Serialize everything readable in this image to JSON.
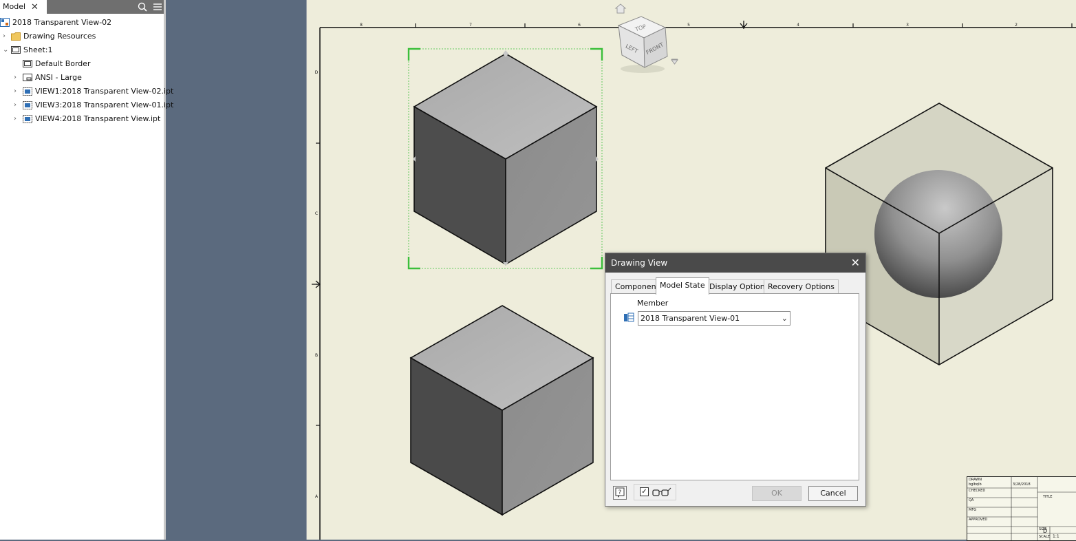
{
  "browser": {
    "tab_label": "Model",
    "tree": [
      {
        "label": "2018 Transparent View-02",
        "icon": "assembly-doc-icon",
        "indent": 0,
        "expander": ""
      },
      {
        "label": "Drawing Resources",
        "icon": "folder-icon",
        "indent": 1,
        "expander": "›"
      },
      {
        "label": "Sheet:1",
        "icon": "sheet-icon",
        "indent": 1,
        "expander": "⌄"
      },
      {
        "label": "Default Border",
        "icon": "border-icon",
        "indent": 2,
        "expander": ""
      },
      {
        "label": "ANSI - Large",
        "icon": "title-block-icon",
        "indent": 2,
        "expander": "›"
      },
      {
        "label": "VIEW1:2018 Transparent View-02.ipt",
        "icon": "drawing-view-icon",
        "indent": 2,
        "expander": "›"
      },
      {
        "label": "VIEW3:2018 Transparent View-01.ipt",
        "icon": "drawing-view-icon",
        "indent": 2,
        "expander": "›"
      },
      {
        "label": "VIEW4:2018 Transparent View.ipt",
        "icon": "drawing-view-icon",
        "indent": 2,
        "expander": "›"
      }
    ]
  },
  "sheet": {
    "top_ruler": [
      "8",
      "7",
      "6",
      "5",
      "4",
      "3",
      "2"
    ],
    "left_ruler": [
      "D",
      "C",
      "B",
      "A"
    ],
    "viewcube_faces": {
      "top": "TOP",
      "left": "LEFT",
      "front": "FRONT"
    }
  },
  "dialog": {
    "title": "Drawing View",
    "tabs": [
      "Component",
      "Model State",
      "Display Options",
      "Recovery Options"
    ],
    "active_tab": "Model State",
    "member_label": "Member",
    "member_value": "2018 Transparent View-01",
    "preview_checked": "✓",
    "ok_label": "OK",
    "cancel_label": "Cancel"
  },
  "titleblock": {
    "drawn": "DRAWN",
    "drawn_by": "bglbqlb",
    "date": "3/28/2018",
    "checked": "CHECKED",
    "qa": "QA",
    "mfg": "MFG",
    "approved": "APPROVED",
    "title": "TITLE",
    "size_label": "SIZE",
    "size": "D",
    "scale_label": "SCALE",
    "scale": "1:1"
  },
  "colors": {
    "sheet_bg": "#eeeddb",
    "workspace_bg": "#5b6a7e",
    "selection_green": "#3bbf3b",
    "dialog_title_bg": "#4a4a4a"
  }
}
